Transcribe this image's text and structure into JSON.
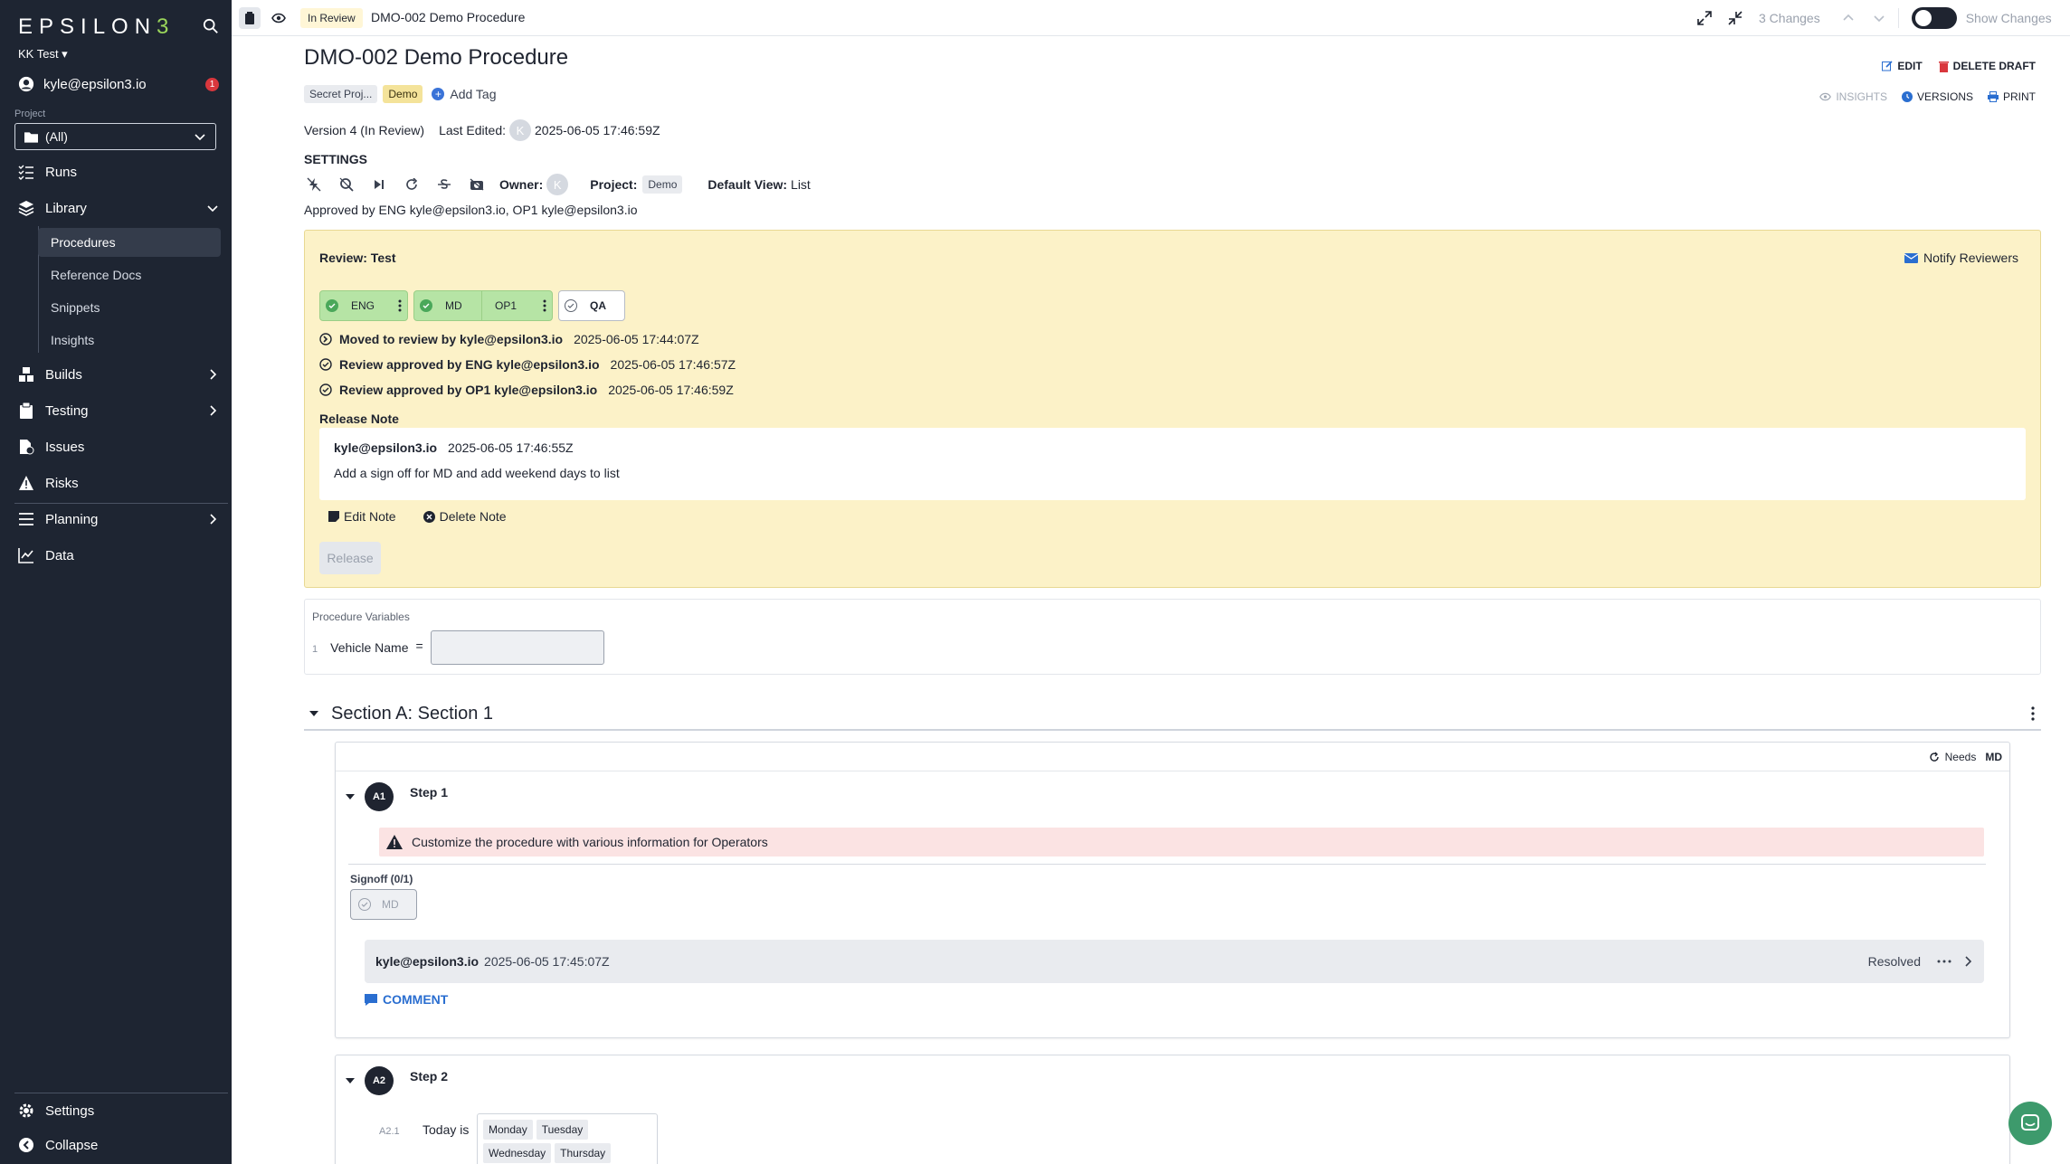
{
  "sidebar": {
    "logo": "EPSILON",
    "logo_last": "3",
    "workspace": "KK Test ▾",
    "user": "kyle@epsilon3.io",
    "user_badge": "1",
    "project_label": "Project",
    "project_value": "(All)",
    "nav": {
      "runs": "Runs",
      "library": "Library",
      "builds": "Builds",
      "testing": "Testing",
      "issues": "Issues",
      "risks": "Risks",
      "planning": "Planning",
      "data": "Data",
      "settings": "Settings",
      "collapse": "Collapse"
    },
    "library_items": [
      "Procedures",
      "Reference Docs",
      "Snippets",
      "Insights"
    ]
  },
  "topbar": {
    "status": "In Review",
    "title": "DMO-002 Demo Procedure",
    "changes": "3 Changes",
    "show_changes": "Show Changes"
  },
  "doc": {
    "title": "DMO-002 Demo Procedure",
    "tags": [
      "Secret Proj...",
      "Demo"
    ],
    "add_tag": "Add Tag",
    "actions": {
      "edit": "EDIT",
      "delete_draft": "DELETE DRAFT",
      "insights": "INSIGHTS",
      "versions": "VERSIONS",
      "print": "PRINT"
    },
    "version": "Version 4 (In Review)",
    "last_edited_label": "Last Edited:",
    "avatar_initial": "K",
    "last_edited": "2025-06-05 17:46:59Z",
    "settings_heading": "SETTINGS",
    "owner_label": "Owner:",
    "project_label": "Project:",
    "project_tag": "Demo",
    "default_view_label": "Default View:",
    "default_view": "List",
    "approved_by": "Approved by ENG kyle@epsilon3.io, OP1 kyle@epsilon3.io"
  },
  "review": {
    "title": "Review: Test",
    "notify": "Notify Reviewers",
    "chips": [
      "ENG",
      "MD",
      "OP1",
      "QA"
    ],
    "log": [
      {
        "text": "Moved to review by kyle@epsilon3.io",
        "time": "2025-06-05 17:44:07Z"
      },
      {
        "text": "Review approved by ENG kyle@epsilon3.io",
        "time": "2025-06-05 17:46:57Z"
      },
      {
        "text": "Review approved by OP1 kyle@epsilon3.io",
        "time": "2025-06-05 17:46:59Z"
      }
    ],
    "release_note_heading": "Release Note",
    "note_author": "kyle@epsilon3.io",
    "note_time": "2025-06-05 17:46:55Z",
    "note_text": "Add a sign off for MD and add weekend days to list",
    "edit_note": "Edit Note",
    "delete_note": "Delete Note",
    "release": "Release"
  },
  "variables": {
    "heading": "Procedure Variables",
    "index": "1",
    "name": "Vehicle Name",
    "equals": "="
  },
  "section": {
    "title": "Section A: Section 1",
    "step1": {
      "needs": "Needs",
      "needs_role": "MD",
      "num": "A1",
      "name": "Step 1",
      "warning": "Customize the procedure with various information for Operators",
      "signoff_heading": "Signoff (0/1)",
      "signoff_role": "MD",
      "comment_author": "kyle@epsilon3.io",
      "comment_time": "2025-06-05 17:45:07Z",
      "comment_status": "Resolved",
      "comment_button": "COMMENT"
    },
    "step2": {
      "num": "A2",
      "name": "Step 2",
      "sub_num": "A2.1",
      "label": "Today is",
      "days": [
        "Monday",
        "Tuesday",
        "Wednesday",
        "Thursday"
      ]
    }
  },
  "colors": {
    "sidebar_bg": "#1e2532",
    "review_bg": "#fcf2c8",
    "accent": "#2a6ed0",
    "approved_green": "#b6e4a5"
  }
}
